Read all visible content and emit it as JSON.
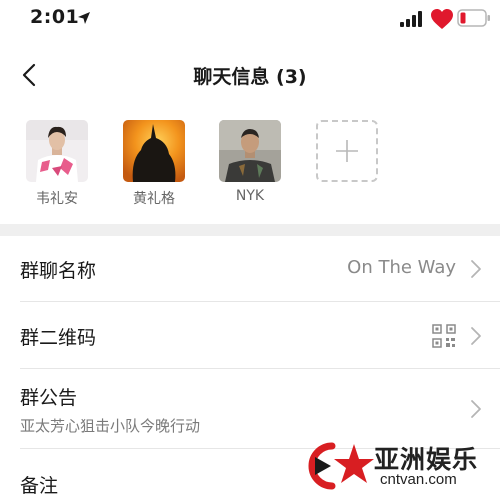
{
  "status_bar": {
    "time": "2:01",
    "icons": [
      "location-arrow-icon",
      "signal-icon",
      "heart-icon",
      "battery-icon"
    ],
    "heart_color": "#e0182d",
    "battery_color": "#e0182d"
  },
  "nav": {
    "back_icon": "chevron-left-icon",
    "title": "聊天信息 (3)"
  },
  "members": [
    {
      "name": "韦礼安",
      "avatar_colors": [
        "#f4f0f2",
        "#e85d8c"
      ]
    },
    {
      "name": "黄礼格",
      "avatar_colors": [
        "#f39a1e",
        "#1a1612"
      ]
    },
    {
      "name": "NYK",
      "avatar_colors": [
        "#9a9890",
        "#3a3a38"
      ]
    }
  ],
  "add_member_icon": "plus-icon",
  "settings": {
    "group_name": {
      "label": "群聊名称",
      "value": "On The Way"
    },
    "qr_code": {
      "label": "群二维码",
      "icon": "qr-code-icon"
    },
    "announcement": {
      "label": "群公告",
      "subtitle": "亚太芳心狙击小队今晚行动"
    },
    "remark": {
      "label": "备注"
    }
  },
  "watermark": {
    "brand": "亚洲娱乐",
    "url": "cntvan.com"
  },
  "colors": {
    "separator": "#efefef",
    "divider": "#e6e6e6",
    "secondary_text": "#8a8a8a"
  }
}
